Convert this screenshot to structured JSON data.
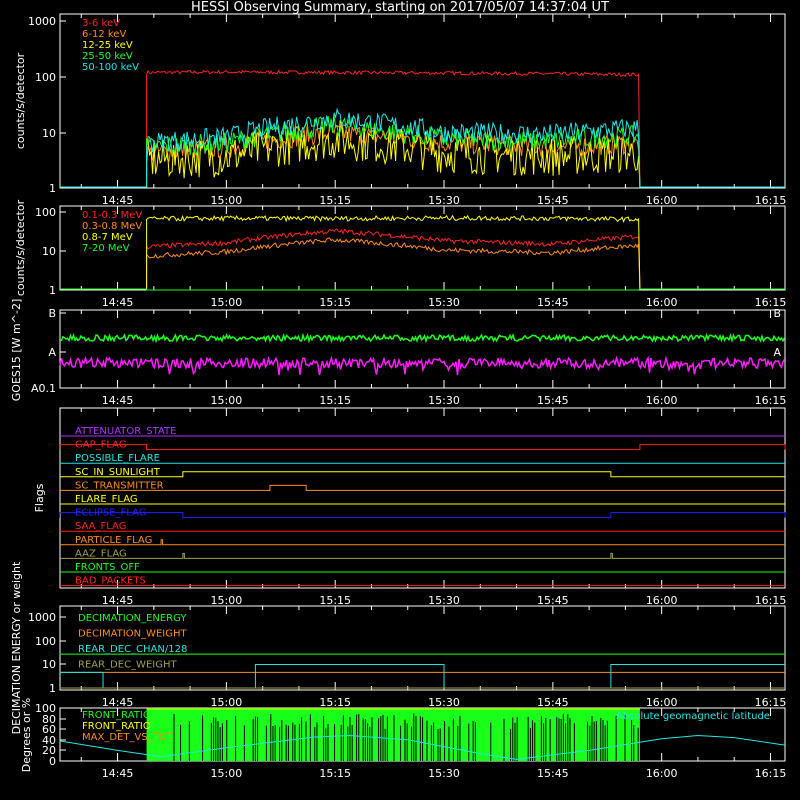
{
  "title": "HESSI Observing Summary, starting on 2017/05/07 14:37:04 UT",
  "colors": {
    "background": "#000000",
    "axis": "#ffffff",
    "red": "#ff2020",
    "orange": "#ff8c1a",
    "yellow": "#ffff00",
    "green": "#1aff1a",
    "cyan": "#22e6e6",
    "magenta": "#ff1aff",
    "blue": "#2020ff",
    "olive": "#a0a040",
    "purple": "#b030ff"
  },
  "time_ticks": [
    "14:45",
    "15:00",
    "15:15",
    "15:30",
    "15:45",
    "16:00",
    "16:15"
  ],
  "chart_data": [
    {
      "id": "panel1",
      "type": "line",
      "ylabel": "counts/s/detector",
      "yscale": "log",
      "ylim": [
        1,
        1000
      ],
      "ytick_labels": [
        "1",
        "10",
        "100",
        "1000"
      ],
      "series": [
        {
          "name": "3-6 keV",
          "color": "#ff2020",
          "active": [
            "14:49",
            "15:57"
          ],
          "points": [
            [
              "14:49",
              98
            ],
            [
              "15:00",
              100
            ],
            [
              "15:15",
              98
            ],
            [
              "15:30",
              96
            ],
            [
              "15:45",
              93
            ],
            [
              "15:57",
              90
            ]
          ]
        },
        {
          "name": "6-12 keV",
          "color": "#ff8c1a",
          "active": [
            "14:49",
            "15:57"
          ],
          "points": [
            [
              "14:49",
              4
            ],
            [
              "15:00",
              5
            ],
            [
              "15:15",
              9
            ],
            [
              "15:30",
              6
            ],
            [
              "15:45",
              5
            ],
            [
              "15:57",
              6
            ]
          ]
        },
        {
          "name": "12-25 keV",
          "color": "#ffff00",
          "active": [
            "14:49",
            "15:57"
          ],
          "points": [
            [
              "14:49",
              3
            ],
            [
              "15:00",
              3.5
            ],
            [
              "15:15",
              7
            ],
            [
              "15:30",
              4
            ],
            [
              "15:45",
              3.5
            ],
            [
              "15:57",
              4
            ]
          ]
        },
        {
          "name": "25-50 keV",
          "color": "#1aff1a",
          "active": [
            "14:49",
            "15:57"
          ],
          "points": [
            [
              "14:49",
              5
            ],
            [
              "15:00",
              6
            ],
            [
              "15:15",
              12
            ],
            [
              "15:30",
              7
            ],
            [
              "15:45",
              6.5
            ],
            [
              "15:57",
              8
            ]
          ]
        },
        {
          "name": "50-100 keV",
          "color": "#22e6e6",
          "active": [
            "14:49",
            "15:57"
          ],
          "points": [
            [
              "14:49",
              6
            ],
            [
              "15:00",
              7.5
            ],
            [
              "15:15",
              16
            ],
            [
              "15:30",
              9
            ],
            [
              "15:45",
              8.5
            ],
            [
              "15:57",
              11
            ]
          ]
        }
      ]
    },
    {
      "id": "panel2",
      "type": "line",
      "ylabel": "counts/s/detector",
      "yscale": "log",
      "ylim": [
        1,
        100
      ],
      "ytick_labels": [
        "1",
        "10",
        "100"
      ],
      "series": [
        {
          "name": "0.1-0.3 MeV",
          "color": "#ff2020",
          "active": [
            "14:49",
            "15:57"
          ],
          "points": [
            [
              "14:49",
              12
            ],
            [
              "15:00",
              15
            ],
            [
              "15:15",
              30
            ],
            [
              "15:30",
              17
            ],
            [
              "15:45",
              14
            ],
            [
              "15:57",
              22
            ]
          ]
        },
        {
          "name": "0.3-0.8 MeV",
          "color": "#ff8c1a",
          "active": [
            "14:49",
            "15:57"
          ],
          "points": [
            [
              "14:49",
              7
            ],
            [
              "15:00",
              9
            ],
            [
              "15:15",
              18
            ],
            [
              "15:30",
              10
            ],
            [
              "15:45",
              8.5
            ],
            [
              "15:57",
              13
            ]
          ]
        },
        {
          "name": "0.8-7 MeV",
          "color": "#ffff00",
          "active": [
            "14:49",
            "15:57"
          ],
          "points": [
            [
              "14:49",
              60
            ],
            [
              "15:00",
              62
            ],
            [
              "15:15",
              61
            ],
            [
              "15:30",
              63
            ],
            [
              "15:45",
              62
            ],
            [
              "15:57",
              58
            ]
          ]
        },
        {
          "name": "7-20 MeV",
          "color": "#1aff1a",
          "active": [
            "14:49",
            "15:57"
          ],
          "points": [
            [
              "14:49",
              1
            ],
            [
              "15:57",
              1
            ]
          ]
        }
      ]
    },
    {
      "id": "panel3",
      "type": "line",
      "ylabel": "GOES15 [W m^-2]",
      "yscale": "log",
      "ytick_labels": [
        "B",
        "A",
        "A0.1"
      ],
      "series": [
        {
          "name": "GOES long",
          "color": "#1aff1a",
          "level": 0.64
        },
        {
          "name": "GOES short",
          "color": "#ff1aff",
          "level": 0.32
        }
      ]
    },
    {
      "id": "panel4",
      "type": "line",
      "ylabel": "Flags",
      "series": [
        {
          "name": "ATTENUATOR_STATE",
          "color": "#b030ff",
          "on": []
        },
        {
          "name": "GAP_FLAG",
          "color": "#ff2020",
          "on": [
            [
              "14:37",
              "14:49"
            ],
            [
              "15:57",
              "16:17"
            ]
          ]
        },
        {
          "name": "POSSIBLE_FLARE",
          "color": "#22e6e6",
          "on": []
        },
        {
          "name": "SC_IN_SUNLIGHT",
          "color": "#ffff00",
          "on": [
            [
              "14:54",
              "15:53"
            ]
          ]
        },
        {
          "name": "SC_TRANSMITTER",
          "color": "#ff8c1a",
          "on": [
            [
              "15:06",
              "15:11"
            ]
          ]
        },
        {
          "name": "FLARE_FLAG",
          "color": "#ffff00",
          "on": []
        },
        {
          "name": "ECLIPSE_FLAG",
          "color": "#2020ff",
          "on": [
            [
              "14:37",
              "14:54"
            ],
            [
              "15:53",
              "16:17"
            ]
          ]
        },
        {
          "name": "SAA_FLAG",
          "color": "#ff2020",
          "on": []
        },
        {
          "name": "PARTICLE_FLAG",
          "color": "#ff8c1a",
          "on": [
            [
              "14:51",
              "14:51"
            ]
          ]
        },
        {
          "name": "AAZ_FLAG",
          "color": "#a0a040",
          "on": [
            [
              "14:54",
              "14:54"
            ],
            [
              "15:53",
              "15:53"
            ]
          ]
        },
        {
          "name": "FRONTS_OFF",
          "color": "#1aff1a",
          "on": []
        },
        {
          "name": "BAD_PACKETS",
          "color": "#ff2020",
          "on": []
        }
      ]
    },
    {
      "id": "panel5",
      "type": "line",
      "ylabel": "DECIMATION ENERGY or weight",
      "yscale": "log",
      "ylim": [
        1,
        1000
      ],
      "ytick_labels": [
        "1",
        "10",
        "100",
        "1000"
      ],
      "series": [
        {
          "name": "DECIMATION_ENERGY",
          "color": "#1aff1a",
          "points": [
            [
              "14:37",
              20
            ],
            [
              "16:17",
              20
            ]
          ]
        },
        {
          "name": "DECIMATION_WEIGHT",
          "color": "#ff8c1a",
          "points": [
            [
              "14:37",
              4
            ],
            [
              "16:17",
              4
            ]
          ]
        },
        {
          "name": "REAR_DEC_CHAN/128",
          "color": "#22e6e6",
          "steps": [
            [
              "14:37",
              4
            ],
            [
              "14:43",
              1
            ],
            [
              "15:04",
              8
            ],
            [
              "15:30",
              1
            ],
            [
              "15:53",
              8
            ],
            [
              "16:17",
              8
            ]
          ]
        },
        {
          "name": "REAR_DEC_WEIGHT",
          "color": "#a0a040",
          "points": [
            [
              "14:37",
              1
            ],
            [
              "16:17",
              1
            ]
          ]
        }
      ]
    },
    {
      "id": "panel6",
      "type": "line",
      "ylabel": "Degrees or %",
      "ylim": [
        0,
        100
      ],
      "ytick_labels": [
        "0",
        "20",
        "40",
        "60",
        "80",
        "100"
      ],
      "annotation": "Absolute geomagnetic latitude",
      "series": [
        {
          "name": "FRONT_RATIO",
          "color": "#1aff1a",
          "active": [
            "14:49",
            "15:57"
          ]
        },
        {
          "name": "FRONT_RATIO",
          "color": "#ffff00"
        },
        {
          "name": "MAX_DET_VS_TOT",
          "color": "#ff8c1a"
        },
        {
          "name": "Absolute geomagnetic latitude",
          "color": "#22e6e6",
          "points": [
            [
              "14:37",
              38
            ],
            [
              "14:45",
              20
            ],
            [
              "14:51",
              8
            ],
            [
              "15:00",
              25
            ],
            [
              "15:12",
              45
            ],
            [
              "15:17",
              48
            ],
            [
              "15:25",
              40
            ],
            [
              "15:35",
              14
            ],
            [
              "15:40",
              3
            ],
            [
              "15:50",
              20
            ],
            [
              "16:00",
              42
            ],
            [
              "16:05",
              48
            ],
            [
              "16:10",
              44
            ],
            [
              "16:17",
              30
            ]
          ]
        }
      ]
    }
  ]
}
